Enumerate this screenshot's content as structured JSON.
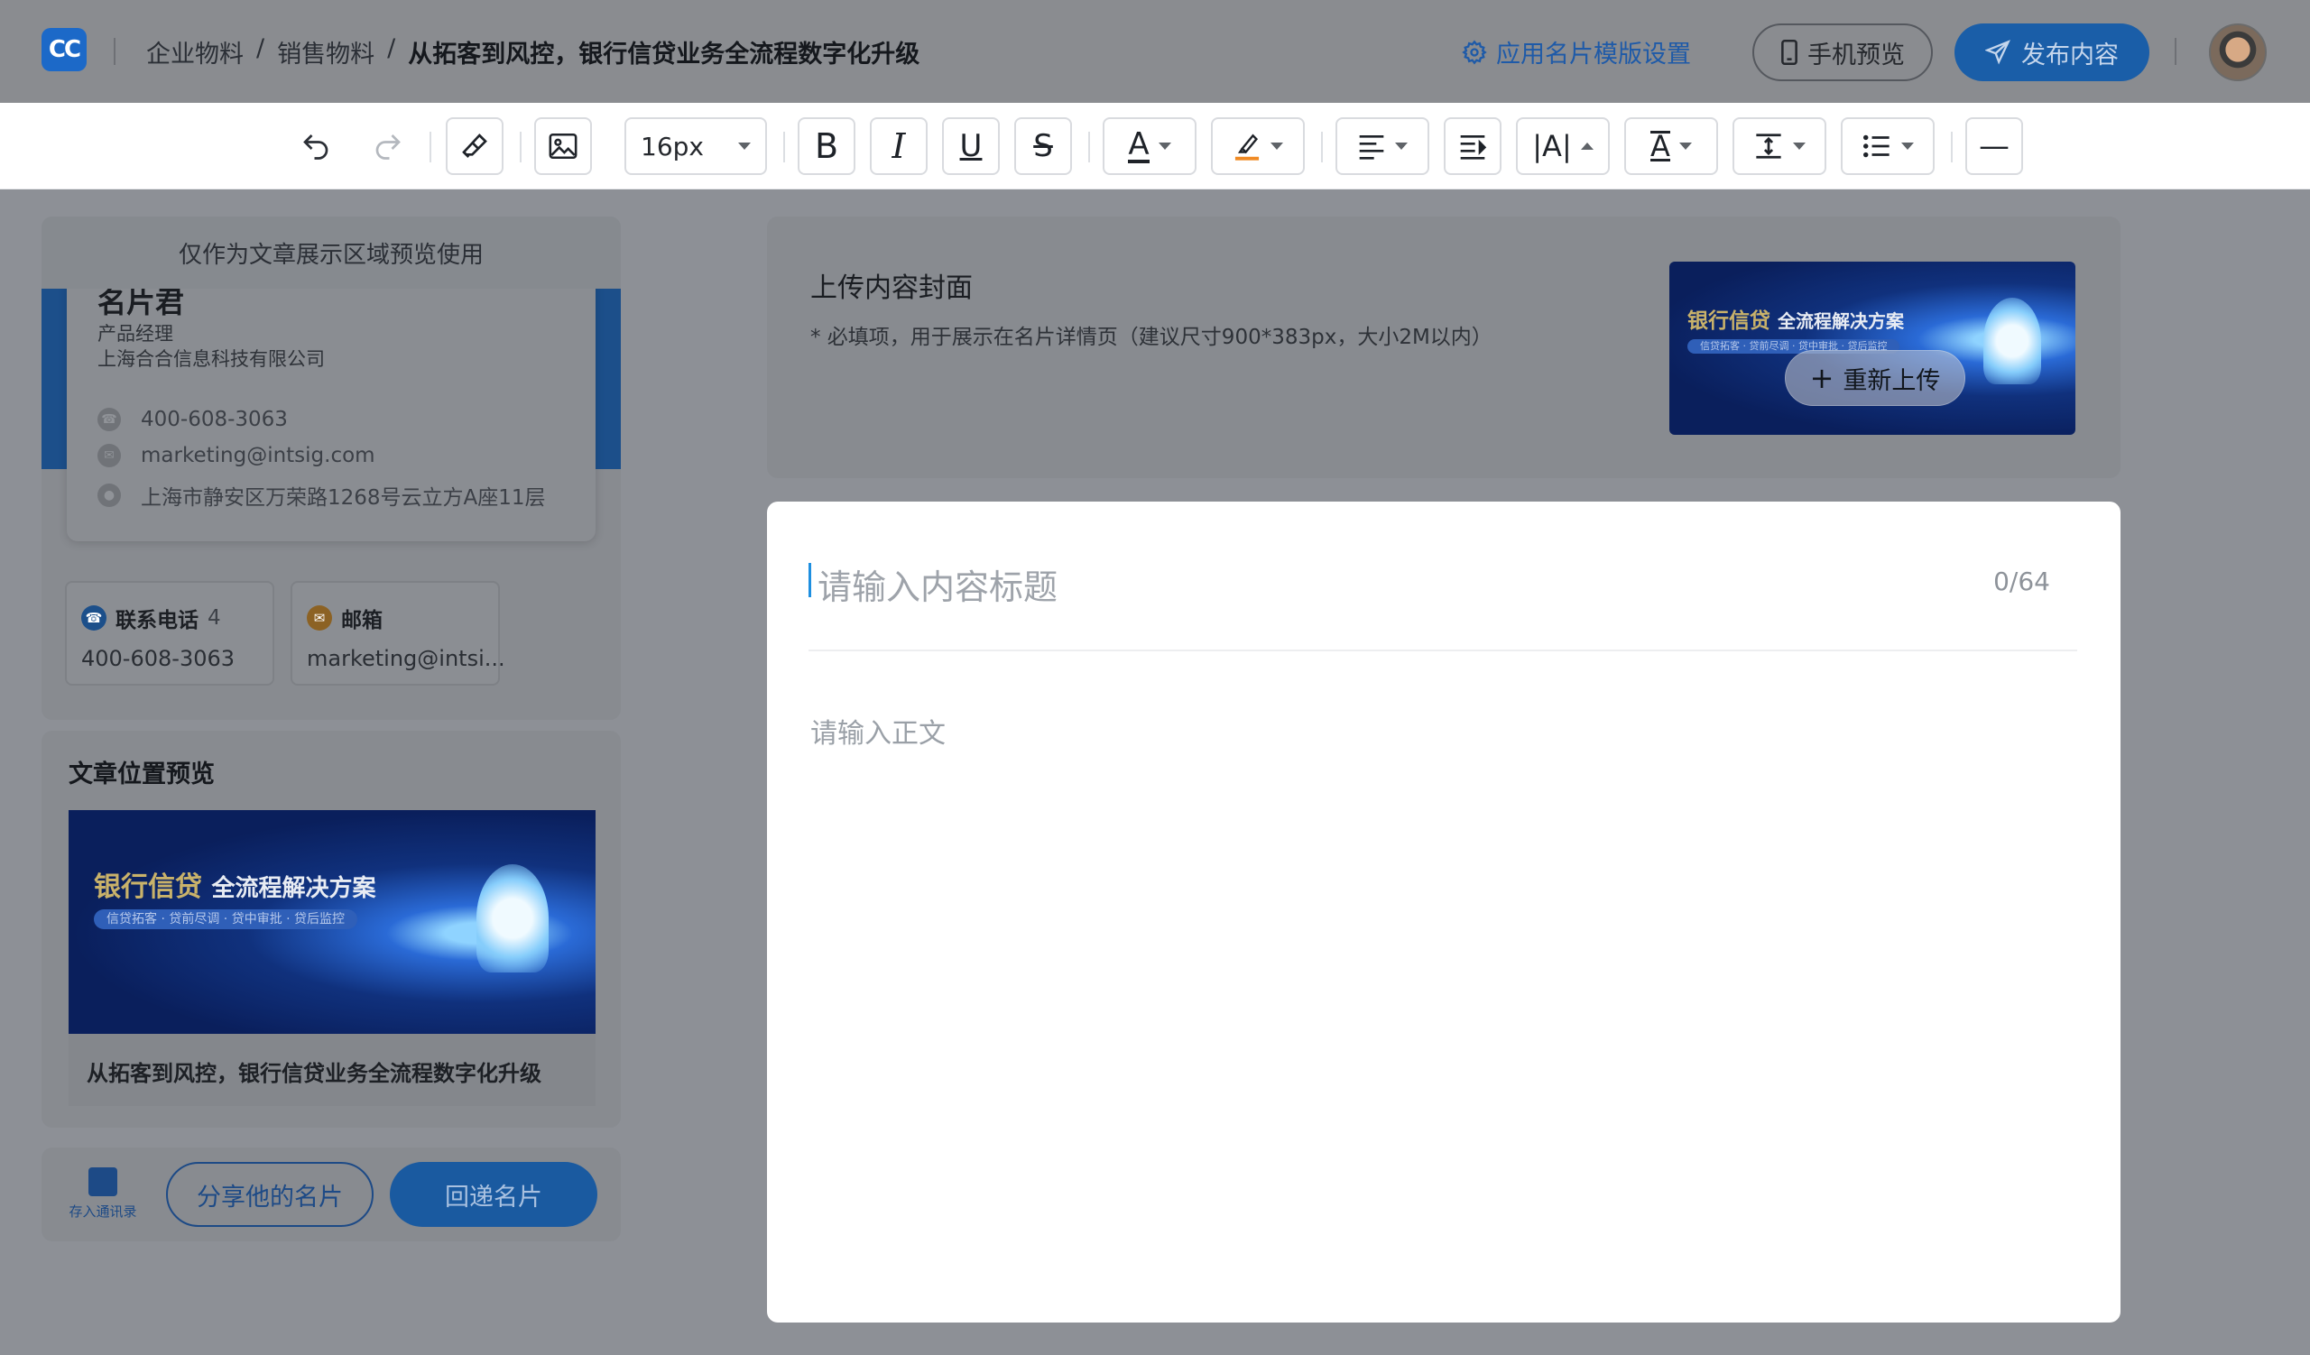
{
  "header": {
    "logo_text": "CC",
    "breadcrumb": [
      "企业物料",
      "销售物料",
      "从拓客到风控，银行信贷业务全流程数字化升级"
    ],
    "breadcrumb_sep": "/",
    "template_link": "应用名片模版设置",
    "preview_button": "手机预览",
    "publish_button": "发布内容"
  },
  "toolbar": {
    "font_size": "16px",
    "bold": "B",
    "italic": "I",
    "underline": "U",
    "strike": "S",
    "font_color": "A",
    "text_style": "A",
    "text_size_adjust": "|A|",
    "divider": "—"
  },
  "left_panel": {
    "preview_tip": "仅作为文章展示区域预览使用",
    "card": {
      "name": "名片君",
      "title": "产品经理",
      "company": "上海合合信息科技有限公司",
      "phone": "400-608-3063",
      "email": "marketing@intsig.com",
      "address": "上海市静安区万荣路1268号云立方A座11层"
    },
    "contacts": [
      {
        "label": "联系电话",
        "count": "4",
        "value": "400-608-3063"
      },
      {
        "label": "邮箱",
        "count": "",
        "value": "marketing@intsi..."
      }
    ],
    "article_preview": {
      "title": "文章位置预览",
      "banner_title_gold": "银行信贷",
      "banner_title_white": "全流程解决方案",
      "banner_sub": "信贷拓客 · 贷前尽调 · 贷中审批 · 贷后监控",
      "caption": "从拓客到风控，银行信贷业务全流程数字化升级"
    },
    "bottom": {
      "save_contact": "存入通讯录",
      "share": "分享他的名片",
      "reply": "回递名片"
    }
  },
  "cover": {
    "title": "上传内容封面",
    "hint": "* 必填项，用于展示在名片详情页（建议尺寸900*383px，大小2M以内）",
    "reupload": "重新上传"
  },
  "editor": {
    "title_placeholder": "请输入内容标题",
    "title_count": "0/64",
    "body_placeholder": "请输入正文"
  },
  "colors": {
    "accent": "#1a5ea8",
    "overlay_bg": "#8d9096",
    "caret": "#1e8fe0"
  }
}
